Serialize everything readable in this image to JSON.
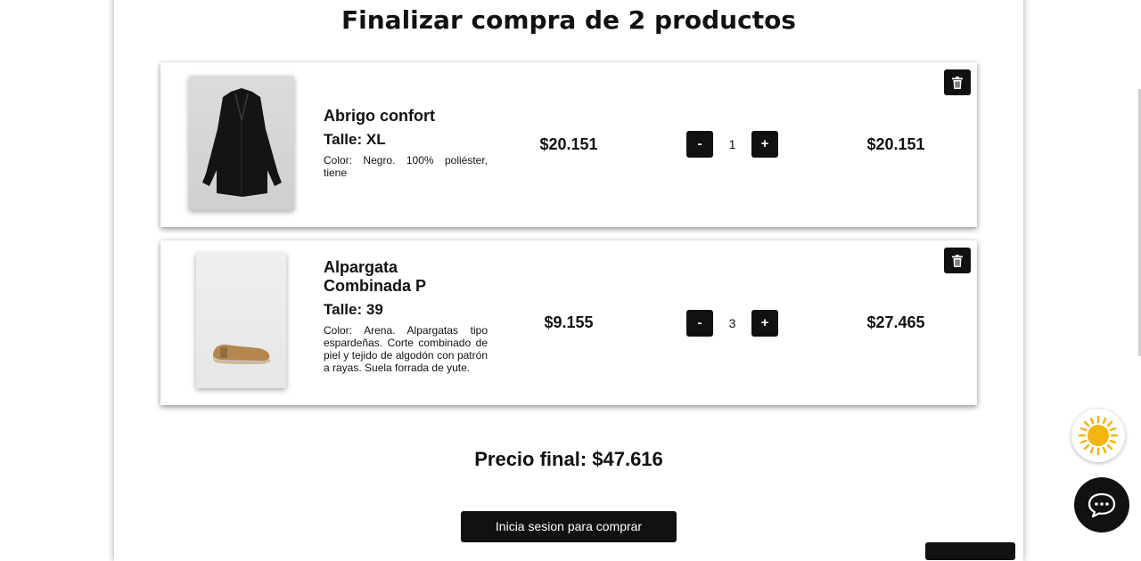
{
  "checkout": {
    "title": "Finalizar compra de 2 productos",
    "items": [
      {
        "name": "Abrigo confort",
        "size": "Talle: XL",
        "description": "Color: Negro. 100% poliéster, tiene",
        "unit_price": "$20.151",
        "quantity": "1",
        "total": "$20.151",
        "minus_label": "-",
        "plus_label": "+",
        "image_icon": "coat-image",
        "delete_icon": "trash-icon"
      },
      {
        "name": "Alpargata Combinada P",
        "size": "Talle: 39",
        "description": "Color: Arena. Alpargatas tipo espardeñas. Corte combinado de piel y tejido de algodón con patrón a rayas. Suela forrada de yute.",
        "unit_price": "$9.155",
        "quantity": "3",
        "total": "$27.465",
        "minus_label": "-",
        "plus_label": "+",
        "image_icon": "espadrille-image",
        "delete_icon": "trash-icon"
      }
    ],
    "final_price": "Precio final: $47.616",
    "buy_button": "Inicia sesion para comprar"
  },
  "floating": {
    "theme_icon": "sun-icon",
    "chat_icon": "chat-icon"
  },
  "colors": {
    "dark": "#111111",
    "sun": "#f5b50f"
  }
}
